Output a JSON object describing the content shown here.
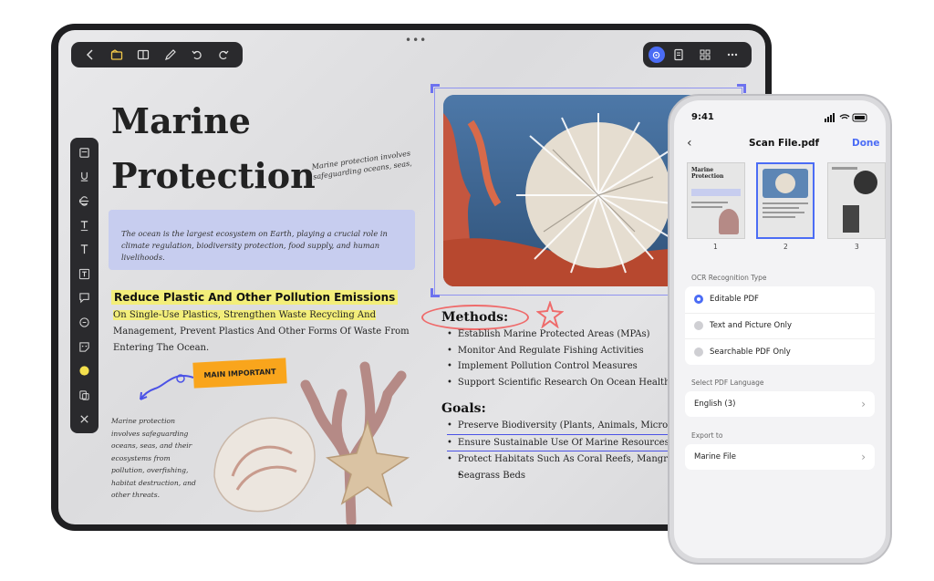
{
  "tablet": {
    "doc_title_line1": "Marine",
    "doc_title_line2": "Protection",
    "note_top": "Marine protection involves safeguarding oceans, seas,",
    "intro": "The ocean is the largest ecosystem on Earth, playing a crucial role in climate regulation, biodiversity protection, food supply, and human livelihoods.",
    "highlight_heading": "Reduce Plastic And Other Pollution Emissions",
    "para_highlighted": "On Single-Use Plastics, Strengthen Waste Recycling And",
    "para_rest": "Management, Prevent Plastics And Other Forms Of Waste From Entering The Ocean.",
    "sticky_label": "MAIN IMPORTANT",
    "note_bottom": "Marine protection involves safeguarding oceans, seas, and their ecosystems from pollution, overfishing, habitat destruction, and other threats.",
    "methods_heading": "Methods:",
    "methods": [
      "Establish Marine Protected Areas (MPAs)",
      "Monitor And Regulate Fishing Activities",
      "Implement Pollution Control Measures",
      "Support Scientific Research On Ocean Health"
    ],
    "goals_heading": "Goals:",
    "goals": [
      "Preserve Biodiversity (Plants, Animals, Micro",
      "Ensure Sustainable Use Of Marine Resources",
      "Protect Habitats Such As Coral Reefs, Mangro",
      "Seagrass Beds"
    ]
  },
  "phone": {
    "time": "9:41",
    "title": "Scan File.pdf",
    "done_label": "Done",
    "thumbnails": [
      {
        "num": "1",
        "title": "Marine Protection"
      },
      {
        "num": "2"
      },
      {
        "num": "3"
      }
    ],
    "ocr_label": "OCR Recognition Type",
    "ocr_options": [
      "Editable PDF",
      "Text and Picture Only",
      "Searchable PDF Only"
    ],
    "language_label": "Select PDF Language",
    "language_value": "English (3)",
    "export_label": "Export to",
    "export_value": "Marine File"
  },
  "colors": {
    "accent": "#4b6cf5",
    "highlight": "#f3ee7a",
    "sticky": "#f9a51c",
    "selection": "#8f93f0"
  }
}
